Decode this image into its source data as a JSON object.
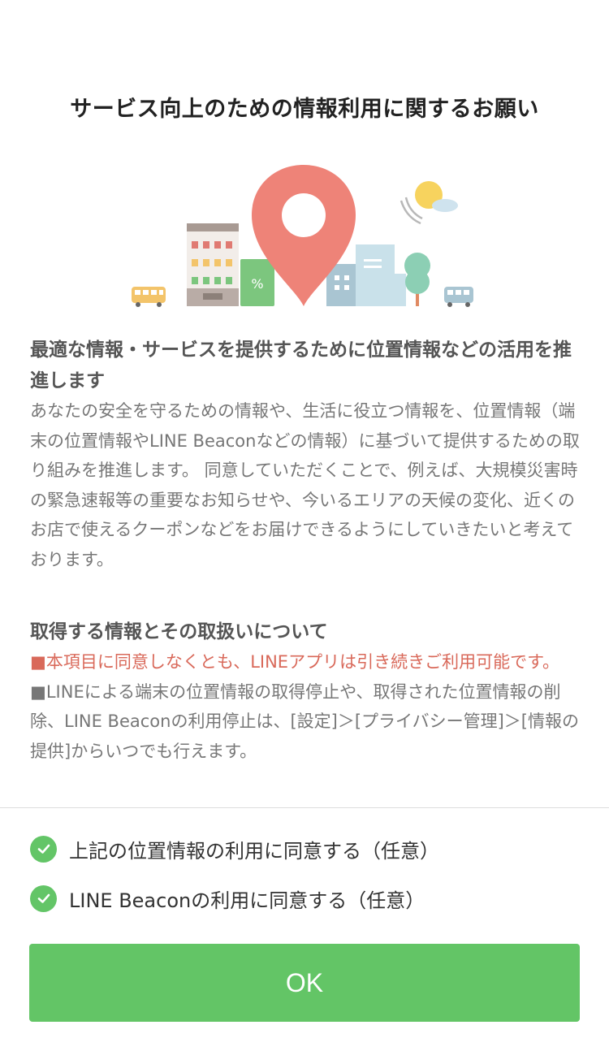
{
  "title": "サービス向上のための情報利用に関するお願い",
  "section1": {
    "heading": "最適な情報・サービスを提供するために位置情報などの活用を推進します",
    "body": "あなたの安全を守るための情報や、生活に役立つ情報を、位置情報（端末の位置情報やLINE Beaconなどの情報）に基づいて提供するための取り組みを推進します。 同意していただくことで、例えば、大規模災害時の緊急速報等の重要なお知らせや、今いるエリアの天候の変化、近くのお店で使えるクーポンなどをお届けできるようにしていきたいと考えております。"
  },
  "section2": {
    "heading": "取得する情報とその取扱いについて",
    "notice_red": "■本項目に同意しなくとも、LINEアプリは引き続きご利用可能です。",
    "notice": "■LINEによる端末の位置情報の取得停止や、取得された位置情報の削除、LINE Beaconの利用停止は、[設定]＞[プライバシー管理]＞[情報の提供]からいつでも行えます。"
  },
  "consents": [
    {
      "label": "上記の位置情報の利用に同意する（任意）",
      "checked": true
    },
    {
      "label": "LINE Beaconの利用に同意する（任意）",
      "checked": true
    }
  ],
  "ok_label": "OK",
  "colors": {
    "accent_green": "#63c566",
    "pin_red": "#ee8378",
    "notice_red": "#d9695a"
  }
}
